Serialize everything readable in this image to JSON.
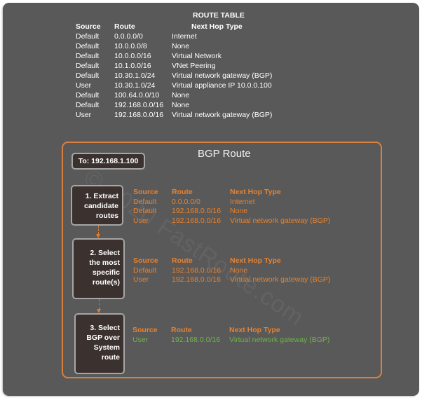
{
  "watermark": "© 2020 FastRoute.com",
  "route_table": {
    "title": "ROUTE TABLE",
    "headers": [
      "Source",
      "Route",
      "Next Hop Type"
    ],
    "rows": [
      [
        "Default",
        "0.0.0.0/0",
        "Internet"
      ],
      [
        "Default",
        "10.0.0.0/8",
        "None"
      ],
      [
        "Default",
        "10.0.0.0/16",
        "Virtual Network"
      ],
      [
        "Default",
        "10.1.0.0/16",
        "VNet Peering"
      ],
      [
        "Default",
        "10.30.1.0/24",
        "Virtual network gateway (BGP)"
      ],
      [
        "User",
        "10.30.1.0/24",
        "Virtual appliance IP 10.0.0.100"
      ],
      [
        "Default",
        "100.64.0.0/10",
        "None"
      ],
      [
        "Default",
        "192.168.0.0/16",
        "None"
      ],
      [
        "User",
        "192.168.0.0/16",
        "Virtual network gateway (BGP)"
      ]
    ]
  },
  "bgp_panel": {
    "title": "BGP Route",
    "destination": "To: 192.168.1.100",
    "colors": {
      "accent": "#e8822e",
      "selected": "#6fb34a",
      "frame": "#d9803e"
    },
    "steps": [
      {
        "label_lines": [
          "1. Extract",
          "candidate",
          "routes"
        ],
        "headers": [
          "Source",
          "Route",
          "Next Hop Type"
        ],
        "rows": [
          [
            "Default",
            "0.0.0.0/0",
            "Internet"
          ],
          [
            "Default",
            "192.168.0.0/16",
            "None"
          ],
          [
            "User",
            "192.168.0.0/16",
            "Virtual network gateway (BGP)"
          ]
        ]
      },
      {
        "label_lines": [
          "2. Select",
          "the most",
          "specific",
          "route(s)"
        ],
        "headers": [
          "Source",
          "Route",
          "Next Hop Type"
        ],
        "rows": [
          [
            "Default",
            "192.168.0.0/16",
            "None"
          ],
          [
            "User",
            "192.168.0.0/16",
            "Virtual network gateway (BGP)"
          ]
        ]
      },
      {
        "label_lines": [
          "3. Select",
          "BGP over",
          "System",
          "route"
        ],
        "headers": [
          "Source",
          "Route",
          "Next Hop Type"
        ],
        "rows": [
          [
            "User",
            "192.168.0.0/16",
            "Virtual network gateway (BGP)"
          ]
        ]
      }
    ]
  }
}
